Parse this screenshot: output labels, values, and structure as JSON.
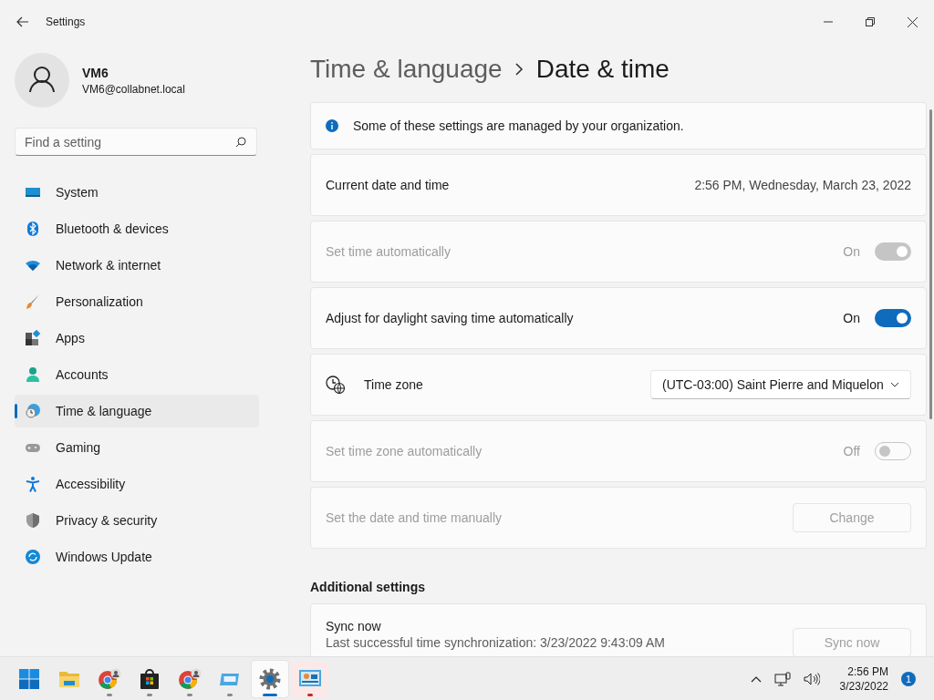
{
  "window": {
    "title": "Settings"
  },
  "user": {
    "name": "VM6",
    "email": "VM6@collabnet.local"
  },
  "search": {
    "placeholder": "Find a setting"
  },
  "nav": [
    {
      "label": "System",
      "kind": "system",
      "selected": false
    },
    {
      "label": "Bluetooth & devices",
      "kind": "bluetooth",
      "selected": false
    },
    {
      "label": "Network & internet",
      "kind": "wifi",
      "selected": false
    },
    {
      "label": "Personalization",
      "kind": "brush",
      "selected": false
    },
    {
      "label": "Apps",
      "kind": "apps",
      "selected": false
    },
    {
      "label": "Accounts",
      "kind": "person",
      "selected": false
    },
    {
      "label": "Time & language",
      "kind": "clock",
      "selected": true
    },
    {
      "label": "Gaming",
      "kind": "gamepad",
      "selected": false
    },
    {
      "label": "Accessibility",
      "kind": "accessibility",
      "selected": false
    },
    {
      "label": "Privacy & security",
      "kind": "shield",
      "selected": false
    },
    {
      "label": "Windows Update",
      "kind": "update",
      "selected": false
    }
  ],
  "breadcrumb": {
    "parent": "Time & language",
    "current": "Date & time"
  },
  "banner": "Some of these settings are managed by your organization.",
  "settings": [
    {
      "kind": "value",
      "label": "Current date and time",
      "value": "2:56 PM, Wednesday, March 23, 2022",
      "disabled": false
    },
    {
      "kind": "toggle",
      "label": "Set time automatically",
      "state_label": "On",
      "on": true,
      "disabled": true
    },
    {
      "kind": "toggle",
      "label": "Adjust for daylight saving time automatically",
      "state_label": "On",
      "on": true,
      "disabled": false
    },
    {
      "kind": "dropdown",
      "label": "Time zone",
      "value": "(UTC-03:00) Saint Pierre and Miquelon",
      "disabled": false
    },
    {
      "kind": "toggle",
      "label": "Set time zone automatically",
      "state_label": "Off",
      "on": false,
      "disabled": true
    },
    {
      "kind": "button",
      "label": "Set the date and time manually",
      "button": "Change",
      "disabled": true
    }
  ],
  "additional": {
    "heading": "Additional settings",
    "title": "Sync now",
    "lines": [
      "Last successful time synchronization: 3/23/2022 9:43:09 AM"
    ],
    "button": "Sync now",
    "disabled": true
  },
  "taskbar": {
    "apps": [
      {
        "kind": "start",
        "running": false,
        "selected": false,
        "attention": false
      },
      {
        "kind": "folder",
        "running": false,
        "selected": false,
        "attention": false
      },
      {
        "kind": "browser",
        "running": true,
        "selected": false,
        "attention": false
      },
      {
        "kind": "store",
        "running": true,
        "selected": false,
        "attention": false
      },
      {
        "kind": "browser",
        "running": true,
        "selected": false,
        "attention": false
      },
      {
        "kind": "window",
        "running": true,
        "selected": false,
        "attention": false
      },
      {
        "kind": "gear",
        "running": true,
        "selected": true,
        "attention": false
      },
      {
        "kind": "remote",
        "running": true,
        "selected": false,
        "attention": true
      }
    ],
    "time": "2:56 PM",
    "date": "3/23/2022",
    "notifications": "1"
  }
}
